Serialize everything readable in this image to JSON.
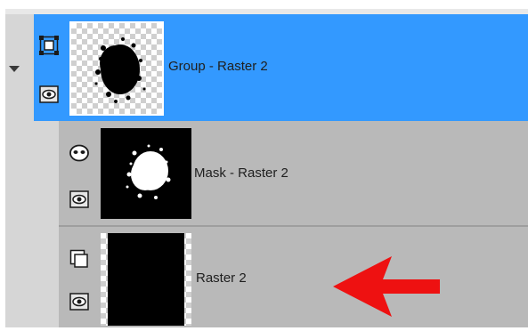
{
  "layers": {
    "group": {
      "name": "Group - Raster 2",
      "icon": "group-layer-icon",
      "visibility_icon": "eye-icon",
      "selected": true,
      "expanded": true
    },
    "mask": {
      "name": "Mask - Raster 2",
      "icon": "mask-layer-icon",
      "visibility_icon": "eye-icon"
    },
    "raster": {
      "name": "Raster 2",
      "icon": "raster-layer-icon",
      "visibility_icon": "eye-icon"
    }
  },
  "annotation": {
    "arrow_color": "#ee1111",
    "arrow_icon": "left-arrow-icon"
  },
  "colors": {
    "selection": "#3399ff",
    "row": "#b9b9b9",
    "panel": "#d6d6d6"
  }
}
